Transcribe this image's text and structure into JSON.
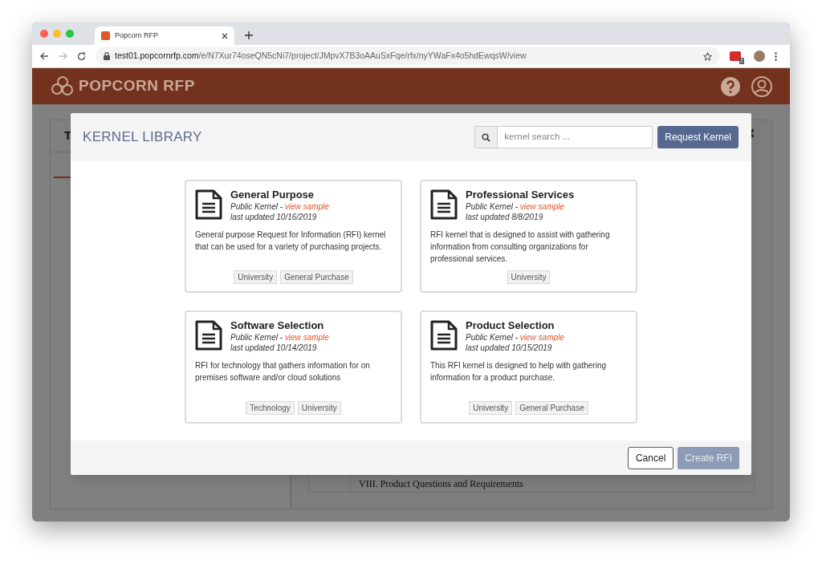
{
  "browser": {
    "tab": {
      "title": "Popcorn RFP"
    },
    "url": {
      "host": "test01.popcornrfp.com",
      "path": "/e/N7Xur74oseQN5cNi7/project/JMpvX7B3oAAuSxFqe/rfx/nyYWaFx4o5hdEwqsW/view"
    },
    "extension_badge": "2"
  },
  "app": {
    "logo": "POPCORN RFP"
  },
  "background": {
    "panel_title": "T",
    "section": "VIII. Product Questions and Requirements"
  },
  "modal": {
    "title": "KERNEL LIBRARY",
    "search": {
      "placeholder": "kernel search ..."
    },
    "request_button": "Request Kernel",
    "kernels": [
      {
        "title": "General Purpose",
        "visibility": "Public Kernel -",
        "link": "view sample",
        "updated": "last updated 10/16/2019",
        "description": "General purpose Request for Information (RFI) kernel that can be used for a variety of purchasing projects.",
        "tags": [
          "University",
          "General Purchase"
        ]
      },
      {
        "title": "Professional Services",
        "visibility": "Public Kernel -",
        "link": "view sample",
        "updated": "last updated 8/8/2019",
        "description": "RFI kernel that is designed to assist with gathering information from consulting organizations for professional services.",
        "tags": [
          "University"
        ]
      },
      {
        "title": "Software Selection",
        "visibility": "Public Kernel -",
        "link": "view sample",
        "updated": "last updated 10/14/2019",
        "description": "RFI for technology that gathers information for on premises software and/or cloud solutions",
        "tags": [
          "Technology",
          "University"
        ]
      },
      {
        "title": "Product Selection",
        "visibility": "Public Kernel -",
        "link": "view sample",
        "updated": "last updated 10/15/2019",
        "description": "This RFI kernel is designed to help with gathering information for a product purchase.",
        "tags": [
          "University",
          "General Purchase"
        ]
      }
    ],
    "buttons": [
      {
        "label": "Cancel",
        "disabled": false
      },
      {
        "label": "Create RFI",
        "disabled": true
      }
    ]
  }
}
